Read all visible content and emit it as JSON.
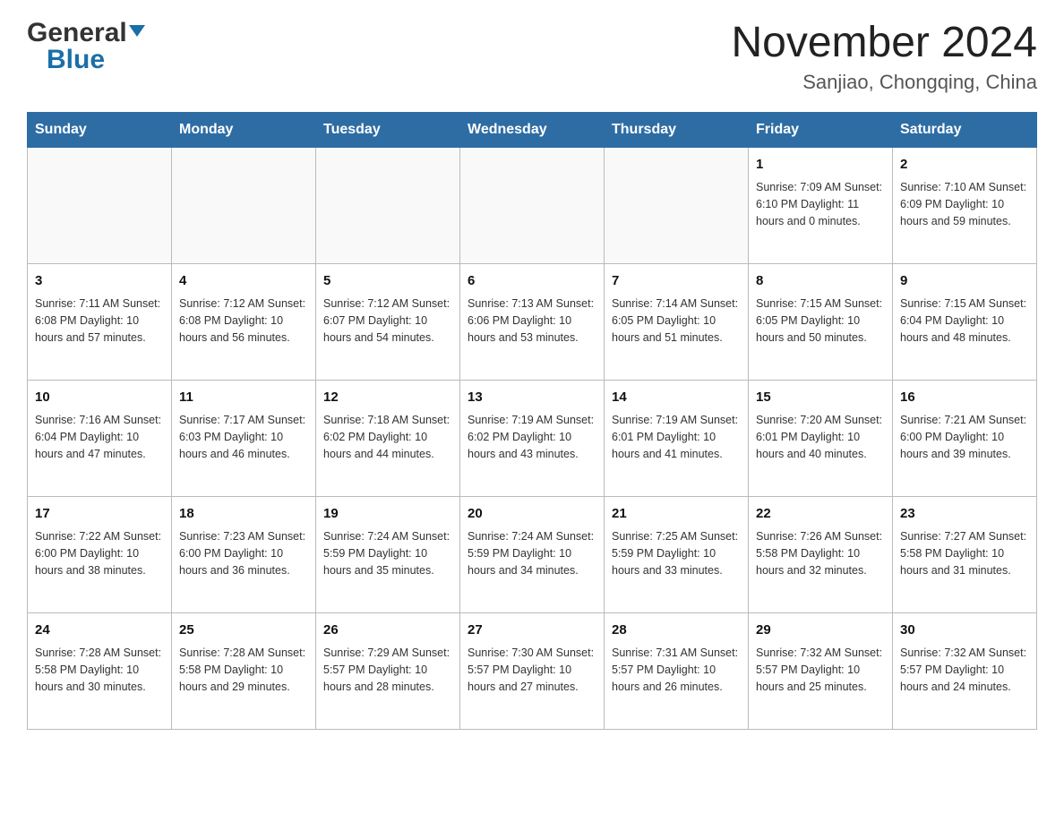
{
  "header": {
    "logo_general": "General",
    "logo_blue": "Blue",
    "title": "November 2024",
    "subtitle": "Sanjiao, Chongqing, China"
  },
  "calendar": {
    "days_of_week": [
      "Sunday",
      "Monday",
      "Tuesday",
      "Wednesday",
      "Thursday",
      "Friday",
      "Saturday"
    ],
    "weeks": [
      [
        {
          "day": "",
          "info": ""
        },
        {
          "day": "",
          "info": ""
        },
        {
          "day": "",
          "info": ""
        },
        {
          "day": "",
          "info": ""
        },
        {
          "day": "",
          "info": ""
        },
        {
          "day": "1",
          "info": "Sunrise: 7:09 AM\nSunset: 6:10 PM\nDaylight: 11 hours\nand 0 minutes."
        },
        {
          "day": "2",
          "info": "Sunrise: 7:10 AM\nSunset: 6:09 PM\nDaylight: 10 hours\nand 59 minutes."
        }
      ],
      [
        {
          "day": "3",
          "info": "Sunrise: 7:11 AM\nSunset: 6:08 PM\nDaylight: 10 hours\nand 57 minutes."
        },
        {
          "day": "4",
          "info": "Sunrise: 7:12 AM\nSunset: 6:08 PM\nDaylight: 10 hours\nand 56 minutes."
        },
        {
          "day": "5",
          "info": "Sunrise: 7:12 AM\nSunset: 6:07 PM\nDaylight: 10 hours\nand 54 minutes."
        },
        {
          "day": "6",
          "info": "Sunrise: 7:13 AM\nSunset: 6:06 PM\nDaylight: 10 hours\nand 53 minutes."
        },
        {
          "day": "7",
          "info": "Sunrise: 7:14 AM\nSunset: 6:05 PM\nDaylight: 10 hours\nand 51 minutes."
        },
        {
          "day": "8",
          "info": "Sunrise: 7:15 AM\nSunset: 6:05 PM\nDaylight: 10 hours\nand 50 minutes."
        },
        {
          "day": "9",
          "info": "Sunrise: 7:15 AM\nSunset: 6:04 PM\nDaylight: 10 hours\nand 48 minutes."
        }
      ],
      [
        {
          "day": "10",
          "info": "Sunrise: 7:16 AM\nSunset: 6:04 PM\nDaylight: 10 hours\nand 47 minutes."
        },
        {
          "day": "11",
          "info": "Sunrise: 7:17 AM\nSunset: 6:03 PM\nDaylight: 10 hours\nand 46 minutes."
        },
        {
          "day": "12",
          "info": "Sunrise: 7:18 AM\nSunset: 6:02 PM\nDaylight: 10 hours\nand 44 minutes."
        },
        {
          "day": "13",
          "info": "Sunrise: 7:19 AM\nSunset: 6:02 PM\nDaylight: 10 hours\nand 43 minutes."
        },
        {
          "day": "14",
          "info": "Sunrise: 7:19 AM\nSunset: 6:01 PM\nDaylight: 10 hours\nand 41 minutes."
        },
        {
          "day": "15",
          "info": "Sunrise: 7:20 AM\nSunset: 6:01 PM\nDaylight: 10 hours\nand 40 minutes."
        },
        {
          "day": "16",
          "info": "Sunrise: 7:21 AM\nSunset: 6:00 PM\nDaylight: 10 hours\nand 39 minutes."
        }
      ],
      [
        {
          "day": "17",
          "info": "Sunrise: 7:22 AM\nSunset: 6:00 PM\nDaylight: 10 hours\nand 38 minutes."
        },
        {
          "day": "18",
          "info": "Sunrise: 7:23 AM\nSunset: 6:00 PM\nDaylight: 10 hours\nand 36 minutes."
        },
        {
          "day": "19",
          "info": "Sunrise: 7:24 AM\nSunset: 5:59 PM\nDaylight: 10 hours\nand 35 minutes."
        },
        {
          "day": "20",
          "info": "Sunrise: 7:24 AM\nSunset: 5:59 PM\nDaylight: 10 hours\nand 34 minutes."
        },
        {
          "day": "21",
          "info": "Sunrise: 7:25 AM\nSunset: 5:59 PM\nDaylight: 10 hours\nand 33 minutes."
        },
        {
          "day": "22",
          "info": "Sunrise: 7:26 AM\nSunset: 5:58 PM\nDaylight: 10 hours\nand 32 minutes."
        },
        {
          "day": "23",
          "info": "Sunrise: 7:27 AM\nSunset: 5:58 PM\nDaylight: 10 hours\nand 31 minutes."
        }
      ],
      [
        {
          "day": "24",
          "info": "Sunrise: 7:28 AM\nSunset: 5:58 PM\nDaylight: 10 hours\nand 30 minutes."
        },
        {
          "day": "25",
          "info": "Sunrise: 7:28 AM\nSunset: 5:58 PM\nDaylight: 10 hours\nand 29 minutes."
        },
        {
          "day": "26",
          "info": "Sunrise: 7:29 AM\nSunset: 5:57 PM\nDaylight: 10 hours\nand 28 minutes."
        },
        {
          "day": "27",
          "info": "Sunrise: 7:30 AM\nSunset: 5:57 PM\nDaylight: 10 hours\nand 27 minutes."
        },
        {
          "day": "28",
          "info": "Sunrise: 7:31 AM\nSunset: 5:57 PM\nDaylight: 10 hours\nand 26 minutes."
        },
        {
          "day": "29",
          "info": "Sunrise: 7:32 AM\nSunset: 5:57 PM\nDaylight: 10 hours\nand 25 minutes."
        },
        {
          "day": "30",
          "info": "Sunrise: 7:32 AM\nSunset: 5:57 PM\nDaylight: 10 hours\nand 24 minutes."
        }
      ]
    ]
  }
}
